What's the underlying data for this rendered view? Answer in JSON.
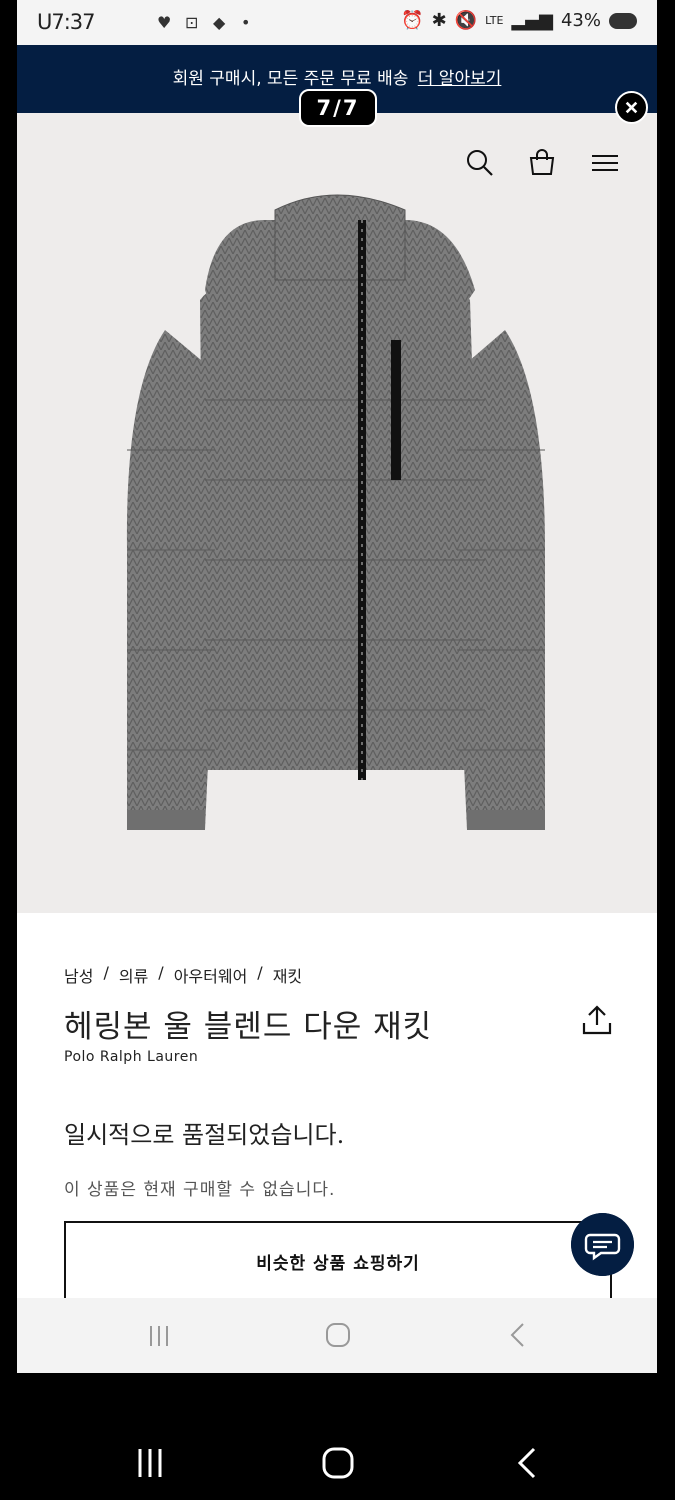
{
  "status_bar": {
    "time": "7:37",
    "left_prefix": "U",
    "battery": "43%",
    "network": "LTE"
  },
  "promo": {
    "text": "회원 구매시, 모든 주문 무료 배송",
    "link": "더 알아보기"
  },
  "gallery": {
    "counter": "7/7"
  },
  "product": {
    "breadcrumb": [
      "남성",
      "의류",
      "아우터웨어",
      "재킷"
    ],
    "title": "헤링본 울 블렌드 다운 재킷",
    "brand": "Polo Ralph Lauren",
    "stock_status": "일시적으로 품절되었습니다.",
    "stock_detail": "이 상품은 현재 구매할 수 없습니다.",
    "shop_similar": "비슷한 상품 쇼핑하기"
  },
  "colors": {
    "navy": "#041e42",
    "image_bg": "#eeeceb"
  }
}
